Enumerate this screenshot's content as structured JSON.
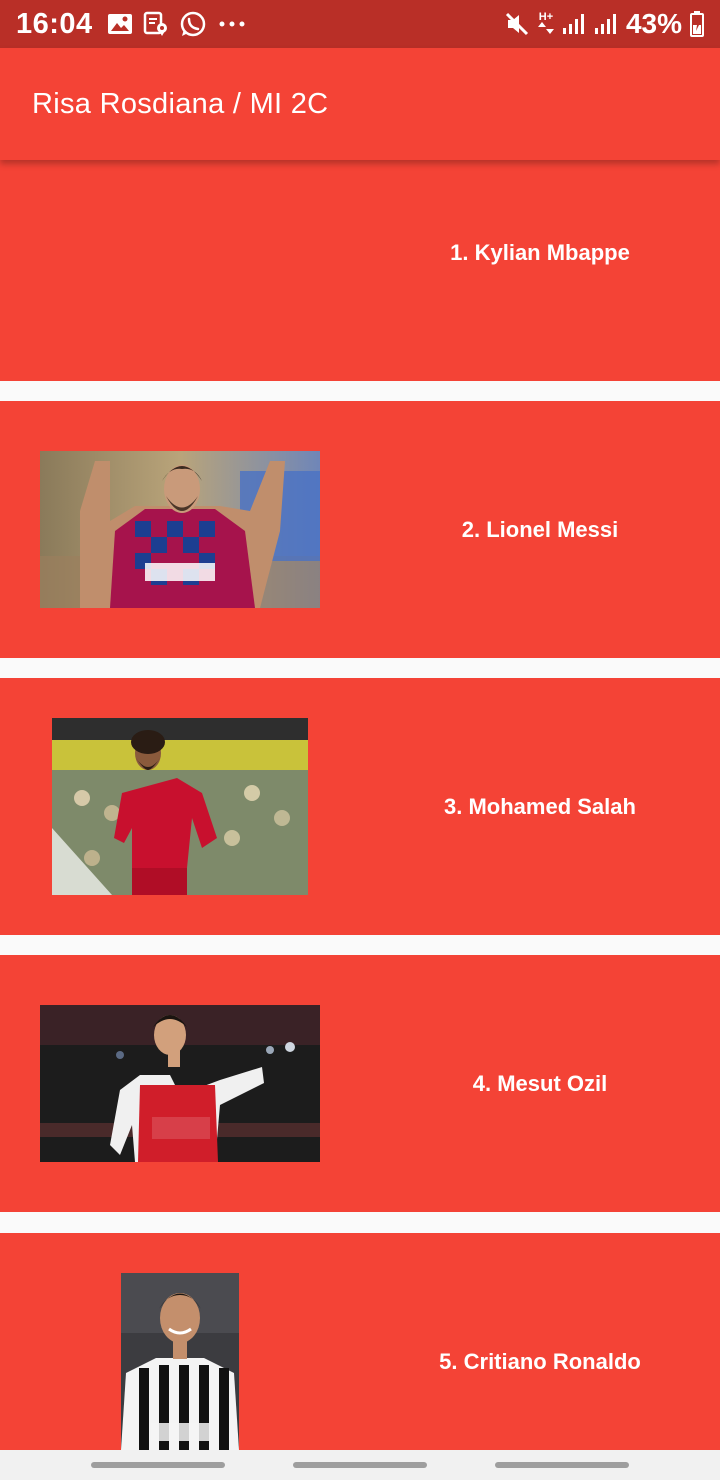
{
  "status_bar": {
    "time": "16:04",
    "battery": "43%",
    "network": "H+",
    "icons_left": [
      "gallery-icon",
      "location-icon",
      "whatsapp-icon",
      "more-icon"
    ],
    "icons_right": [
      "mute-icon",
      "network-type-icon",
      "signal-icon",
      "signal-icon",
      "battery-icon"
    ]
  },
  "app_bar": {
    "title": "Risa Rosdiana / MI 2C"
  },
  "players": [
    {
      "label": "1. Kylian Mbappe",
      "image": "none"
    },
    {
      "label": "2. Lionel Messi",
      "image": "messi-photo"
    },
    {
      "label": "3. Mohamed Salah",
      "image": "salah-photo"
    },
    {
      "label": "4. Mesut Ozil",
      "image": "ozil-photo"
    },
    {
      "label": "5. Critiano Ronaldo",
      "image": "ronaldo-photo"
    }
  ],
  "colors": {
    "primary": "#f44336",
    "primary_dark": "#b92f27",
    "background": "#fafafa",
    "text_on_primary": "#ffffff"
  }
}
